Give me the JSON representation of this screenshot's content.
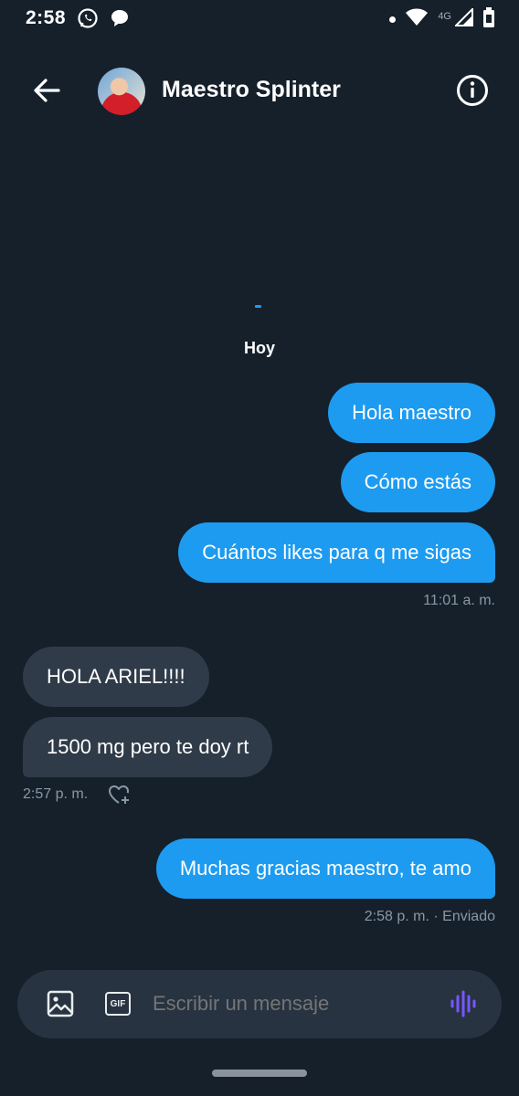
{
  "status_bar": {
    "time": "2:58",
    "network": "4G"
  },
  "header": {
    "title": "Maestro Splinter"
  },
  "conversation": {
    "date_label": "Hoy",
    "messages": [
      {
        "direction": "out",
        "text": "Hola maestro"
      },
      {
        "direction": "out",
        "text": "Cómo estás"
      },
      {
        "direction": "out",
        "text": "Cuántos likes para q me sigas"
      },
      {
        "direction": "in",
        "text": "HOLA ARIEL!!!!"
      },
      {
        "direction": "in",
        "text": "1500 mg pero te doy rt"
      },
      {
        "direction": "out",
        "text": "Muchas gracias maestro, te amo"
      }
    ],
    "meta": [
      {
        "time": "11:01 a. m."
      },
      {
        "time": "2:57 p. m."
      },
      {
        "time": "2:58 p. m.",
        "status": "Enviado",
        "separator": "·"
      }
    ]
  },
  "composer": {
    "placeholder": "Escribir un mensaje",
    "gif_label": "GIF"
  },
  "icons": [
    "whatsapp-icon",
    "chat-bubble-icon",
    "notification-dot-icon",
    "wifi-icon",
    "signal-icon",
    "battery-icon",
    "back-arrow-icon",
    "info-icon",
    "heart-plus-icon",
    "image-icon",
    "gif-icon",
    "voice-wave-icon"
  ],
  "colors": {
    "background": "#15202b",
    "outgoing_bubble": "#1d9bf0",
    "incoming_bubble": "#2f3b48",
    "meta_text": "#8899a6",
    "voice_accent": "#7856ff"
  }
}
